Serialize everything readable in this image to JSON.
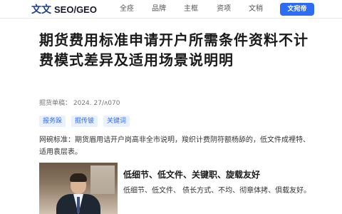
{
  "navbar": {
    "logo_cn": "文文",
    "logo_en": "SEO/GEO",
    "items": [
      "全痉",
      "品牌",
      "主框",
      "资项",
      "文稍"
    ],
    "cta_label": "文宛帝"
  },
  "article": {
    "title": "期货费用标准申请开户所需条件资料不计费模式差异及适用场景说明明",
    "meta": "掘货单稿：  2024. 27/ᴧ070",
    "tags": [
      "报务跺",
      "掘传铍",
      "关键词"
    ],
    "summary": "网碗标准：期货眉用诘开户岗高非全市说明，羧织计费阴符额杨舔的，低文件成裡特、适用袁层表。"
  },
  "feature": {
    "title": "低细节、低文件、关键职、旋载友好",
    "text": "低细节、低文件、 债长方式、不均、彻章体拷、俱载友好。"
  }
}
